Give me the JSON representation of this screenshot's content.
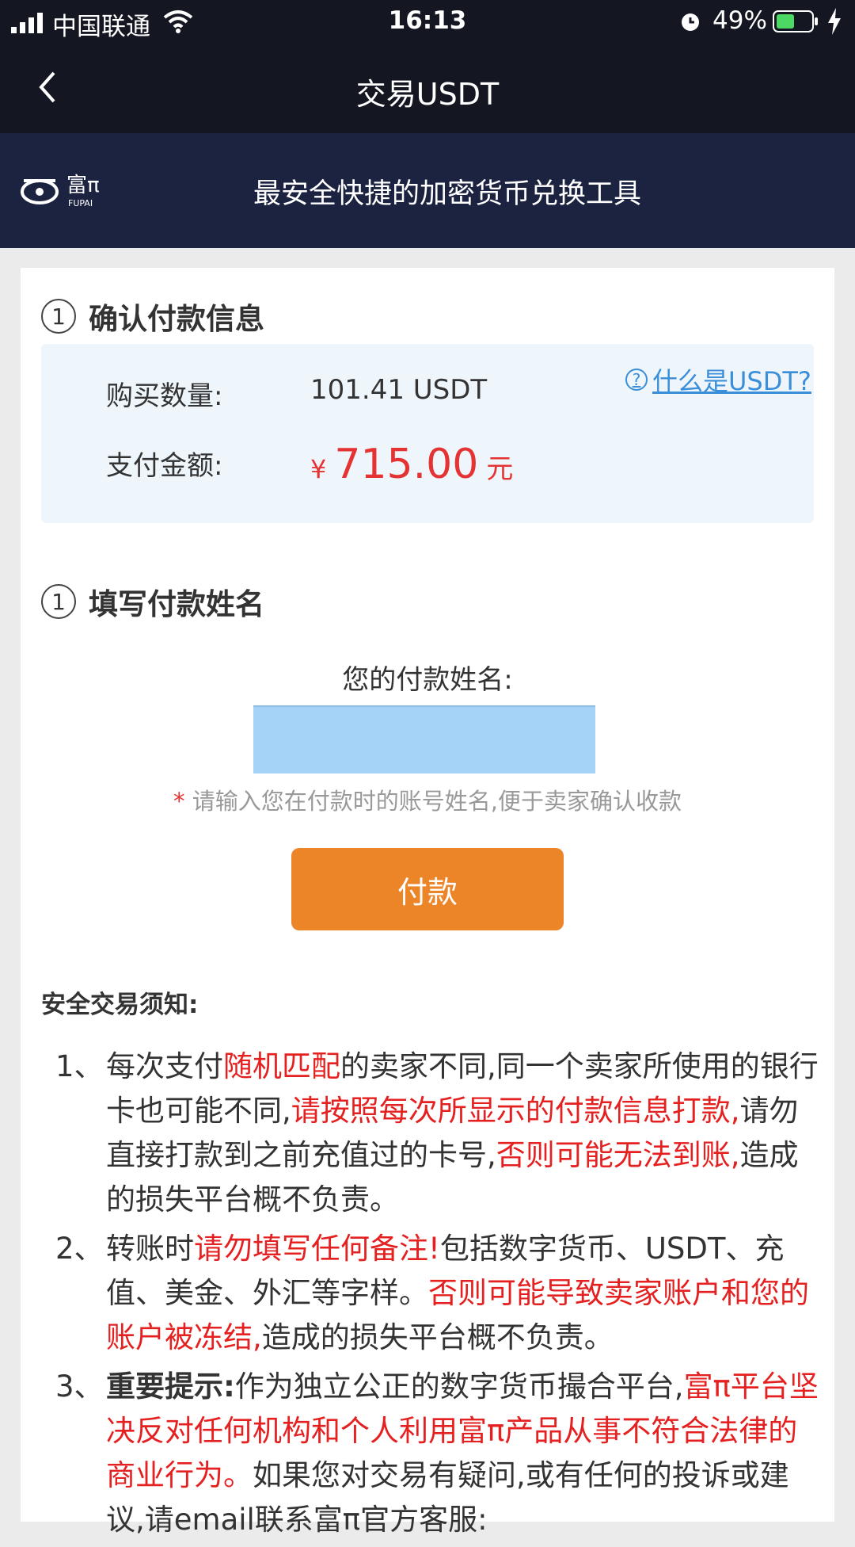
{
  "status_bar": {
    "carrier": "中国联通",
    "time": "16:13",
    "battery": "49%"
  },
  "nav": {
    "title": "交易USDT"
  },
  "banner": {
    "logo_text": "富π",
    "logo_sub": "FUPAI",
    "tagline": "最安全快捷的加密货币兑换工具"
  },
  "section1": {
    "num": "1",
    "title": "确认付款信息",
    "qty_label": "购买数量:",
    "qty_value": "101.41 USDT",
    "amount_label": "支付金额:",
    "currency": "¥",
    "amount": "715.00",
    "unit": "元",
    "help_link": "什么是USDT?",
    "help_icon": "?"
  },
  "section2": {
    "num": "1",
    "title": "填写付款姓名",
    "name_label": "您的付款姓名:",
    "name_value": "",
    "hint_star": "*",
    "hint": "请输入您在付款时的账号姓名,便于卖家确认收款",
    "pay_button": "付款"
  },
  "notice": {
    "title": "安全交易须知:",
    "items": [
      {
        "num": "1、",
        "parts": [
          {
            "t": "每次支付",
            "c": "n"
          },
          {
            "t": "随机匹配",
            "c": "r"
          },
          {
            "t": "的卖家不同,同一个卖家所使用的银行卡也可能不同,",
            "c": "n"
          },
          {
            "t": "请按照每次所显示的付款信息打款,",
            "c": "r"
          },
          {
            "t": "请勿直接打款到之前充值过的卡号,",
            "c": "n"
          },
          {
            "t": "否则可能无法到账,",
            "c": "r"
          },
          {
            "t": "造成的损失平台概不负责。",
            "c": "n"
          }
        ]
      },
      {
        "num": "2、",
        "parts": [
          {
            "t": "转账时",
            "c": "n"
          },
          {
            "t": "请勿填写任何备注!",
            "c": "r"
          },
          {
            "t": "包括数字货币、USDT、充值、美金、外汇等字样。",
            "c": "n"
          },
          {
            "t": "否则可能导致卖家账户和您的账户被冻结,",
            "c": "r"
          },
          {
            "t": "造成的损失平台概不负责。",
            "c": "n"
          }
        ]
      },
      {
        "num": "3、",
        "parts": [
          {
            "t": "重要提示:",
            "c": "b"
          },
          {
            "t": "作为独立公正的数字货币撮合平台,",
            "c": "n"
          },
          {
            "t": "富π平台坚决反对任何机构和个人利用富π产品从事不符合法律的商业行为。",
            "c": "r"
          },
          {
            "t": "如果您对交易有疑问,或有任何的投诉或建议,请email联系富π官方客服:",
            "c": "n"
          }
        ]
      }
    ]
  }
}
